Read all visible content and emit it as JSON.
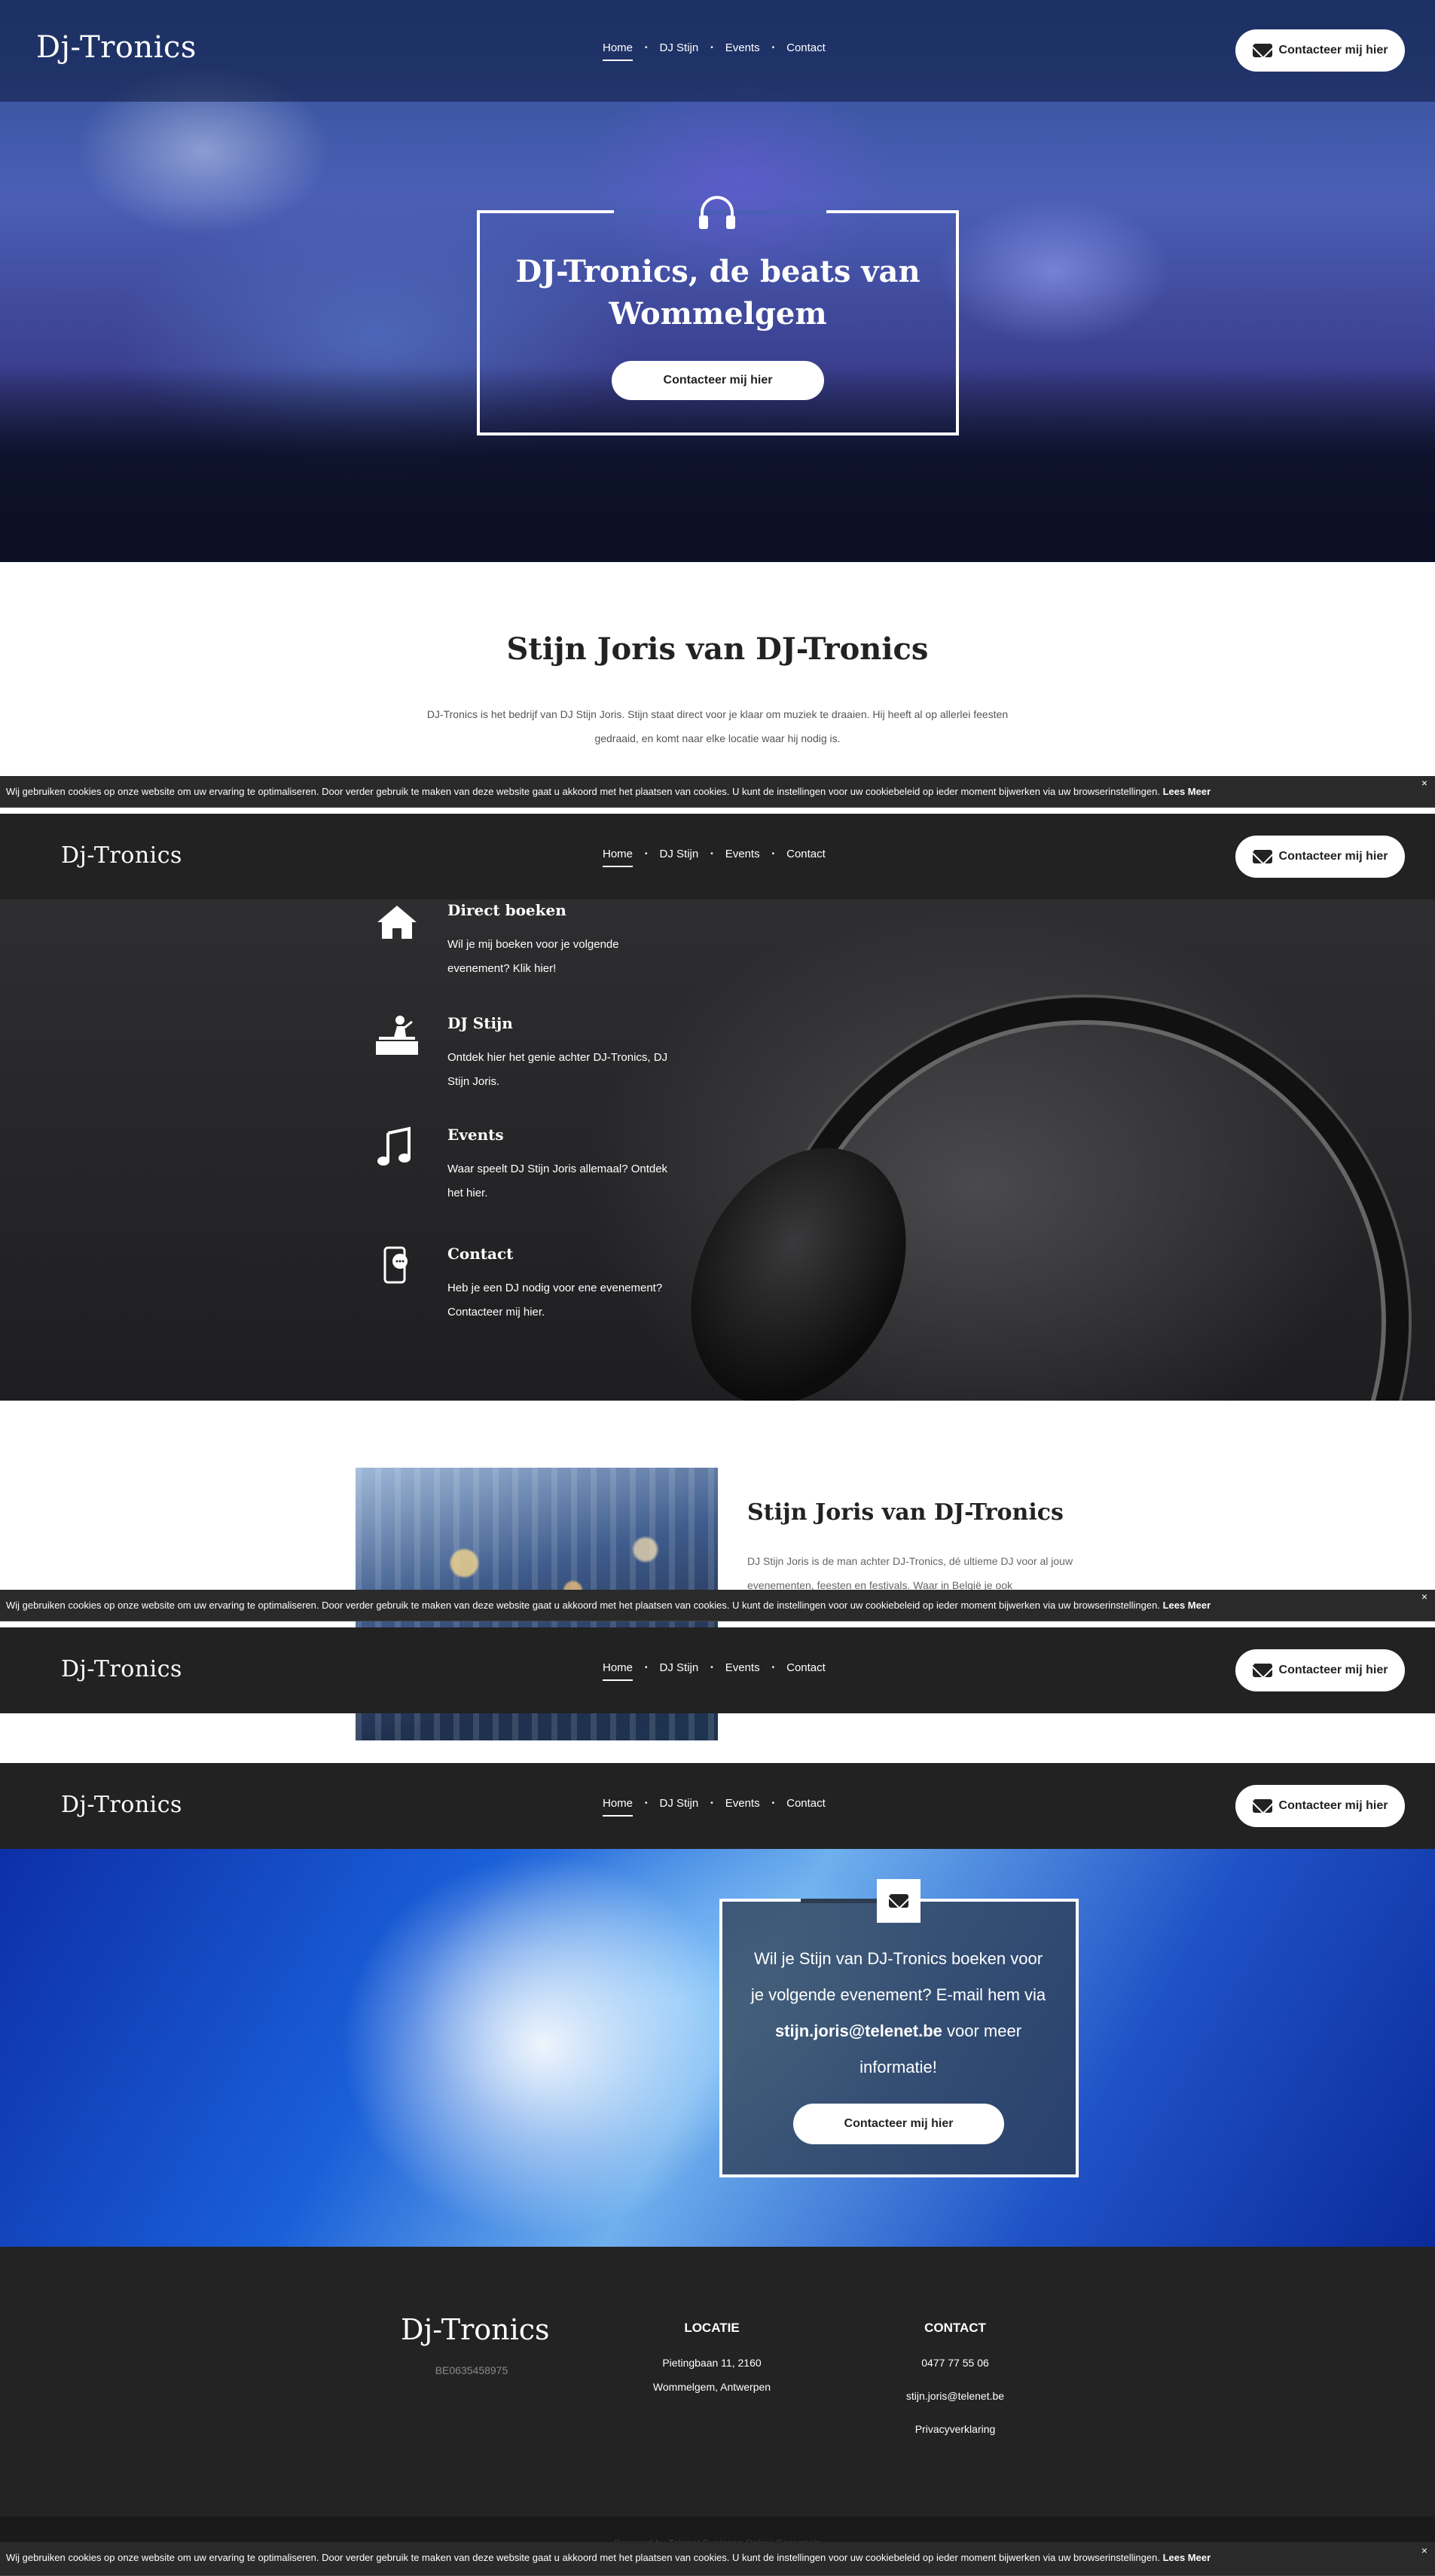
{
  "brand": {
    "logo": "Dj-Tronics"
  },
  "nav": {
    "items": [
      "Home",
      "DJ Stijn",
      "Events",
      "Contact"
    ],
    "separator": "•",
    "cta_label": "Contacteer mij hier"
  },
  "hero": {
    "title": "DJ-Tronics, de beats van Wommelgem",
    "button_label": "Contacteer mij hier",
    "icon": "headphones-icon"
  },
  "intro": {
    "title": "Stijn Joris van DJ-Tronics",
    "text": "DJ-Tronics is het bedrijf van DJ Stijn Joris. Stijn staat direct voor je klaar om muziek te draaien. Hij heeft al op allerlei feesten gedraaid, en komt naar elke locatie waar hij nodig is."
  },
  "cookie": {
    "text": "Wij gebruiken cookies op onze website om uw ervaring te optimaliseren. Door verder gebruik te maken van deze website gaat u akkoord met het plaatsen van cookies. U kunt de instellingen voor uw cookiebeleid op ieder moment bijwerken via uw browserinstellingen.",
    "more_label": "Lees Meer",
    "close_label": "×"
  },
  "services": [
    {
      "icon": "home-icon",
      "title": "Direct boeken",
      "text": "Wil je mij boeken voor je volgende evenement? Klik hier!"
    },
    {
      "icon": "dj-icon",
      "title": "DJ Stijn",
      "text": "Ontdek hier het genie achter DJ-Tronics, DJ Stijn Joris."
    },
    {
      "icon": "music-note-icon",
      "title": "Events",
      "text": "Waar speelt DJ Stijn Joris allemaal? Ontdek het hier."
    },
    {
      "icon": "phone-chat-icon",
      "title": "Contact",
      "text": "Heb je een DJ nodig voor ene evenement? Contacteer mij hier."
    }
  ],
  "about": {
    "title": "Stijn Joris van DJ-Tronics",
    "text": "DJ Stijn Joris is de man achter DJ-Tronics, dé ultieme DJ voor al jouw evenementen, feesten en festivals. Waar in België je ook"
  },
  "cta": {
    "text_before": "Wil je Stijn van DJ-Tronics boeken voor je volgende evenement? E-mail hem via ",
    "email": "stijn.joris@telenet.be",
    "text_after": " voor meer informatie!",
    "button_label": "Contacteer mij hier",
    "icon": "mail-icon"
  },
  "footer": {
    "logo": "Dj-Tronics",
    "vat": "BE0635458975",
    "location_heading": "LOCATIE",
    "address_line1": "Pietingbaan 11, 2160",
    "address_line2": "Wommelgem, Antwerpen",
    "contact_heading": "CONTACT",
    "phone": "0477 77 55 06",
    "email": "stijn.joris@telenet.be",
    "privacy": "Privacyverklaring",
    "powered": "Powered by Telenet Business Online Essentials"
  }
}
